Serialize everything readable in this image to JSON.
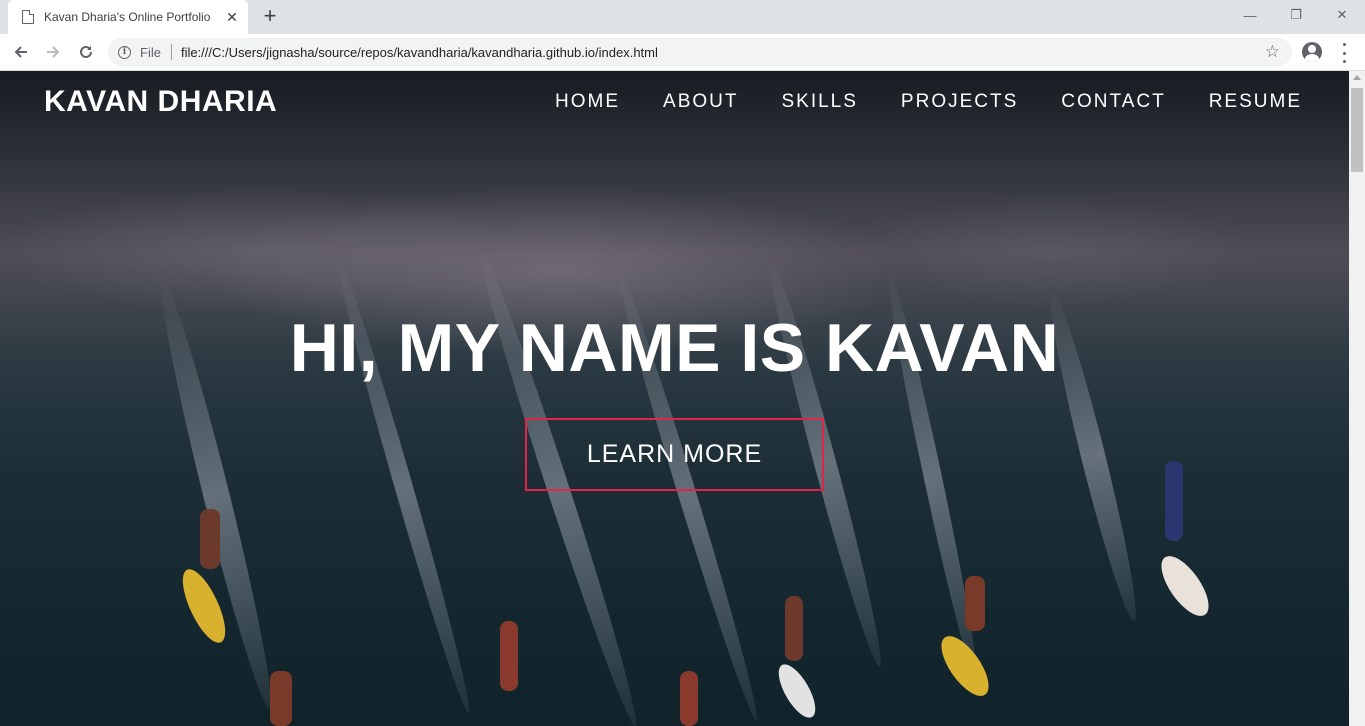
{
  "browser": {
    "tab_title": "Kavan Dharia's Online Portfolio",
    "tab_close": "✕",
    "new_tab": "+",
    "scheme_label": "File",
    "url": "file:///C:/Users/jignasha/source/repos/kavandharia/kavandharia.github.io/index.html",
    "window_controls": [
      "—",
      "❐",
      "✕"
    ]
  },
  "site": {
    "brand": "KAVAN DHARIA",
    "nav": [
      "HOME",
      "ABOUT",
      "SKILLS",
      "PROJECTS",
      "CONTACT",
      "RESUME"
    ],
    "headline": "HI, MY NAME IS KAVAN",
    "cta_label": "LEARN MORE",
    "accent_color": "#e0254a"
  },
  "icons": [
    "page-icon",
    "back-arrow-icon",
    "forward-arrow-icon",
    "reload-icon",
    "info-icon",
    "star-icon",
    "profile-icon",
    "menu-icon"
  ]
}
